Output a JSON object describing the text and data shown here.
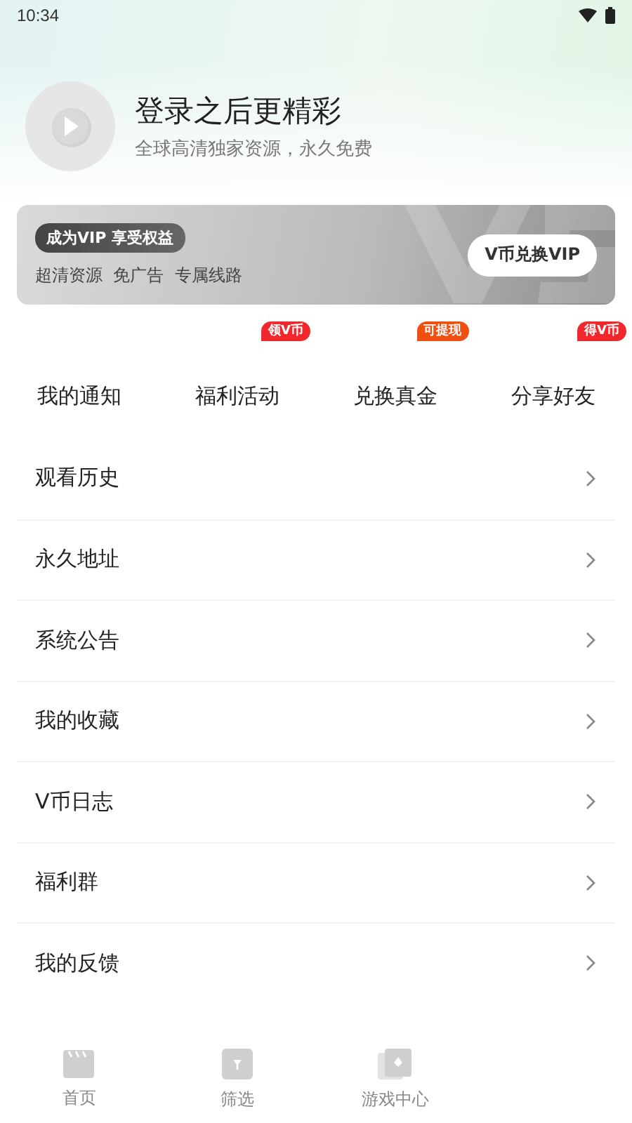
{
  "status_bar": {
    "time": "10:34"
  },
  "profile": {
    "title": "登录之后更精彩",
    "subtitle": "全球高清独家资源，永久免费"
  },
  "vip_card": {
    "badge": "成为VIP 享受权益",
    "features": "超清资源  免广告  专属线路",
    "button": "V币兑换VIP"
  },
  "quick_actions": [
    {
      "label": "我的通知"
    },
    {
      "label": "福利活动",
      "badge": "领V币",
      "color": "#f0282d"
    },
    {
      "label": "兑换真金",
      "badge": "可提现",
      "color": "#f0500f"
    },
    {
      "label": "分享好友",
      "badge": "得V币",
      "color": "#f0282d"
    }
  ],
  "menu": [
    {
      "label": "观看历史"
    },
    {
      "label": "永久地址"
    },
    {
      "label": "系统公告"
    },
    {
      "label": "我的收藏"
    },
    {
      "label": "V币日志"
    },
    {
      "label": "福利群"
    },
    {
      "label": "我的反馈"
    }
  ],
  "tab_bar": [
    {
      "label": "首页",
      "kind": "clapper",
      "selected": false
    },
    {
      "label": "筛选",
      "kind": "filter",
      "selected": false
    },
    {
      "label": "游戏中心",
      "kind": "cards",
      "selected": false
    }
  ]
}
